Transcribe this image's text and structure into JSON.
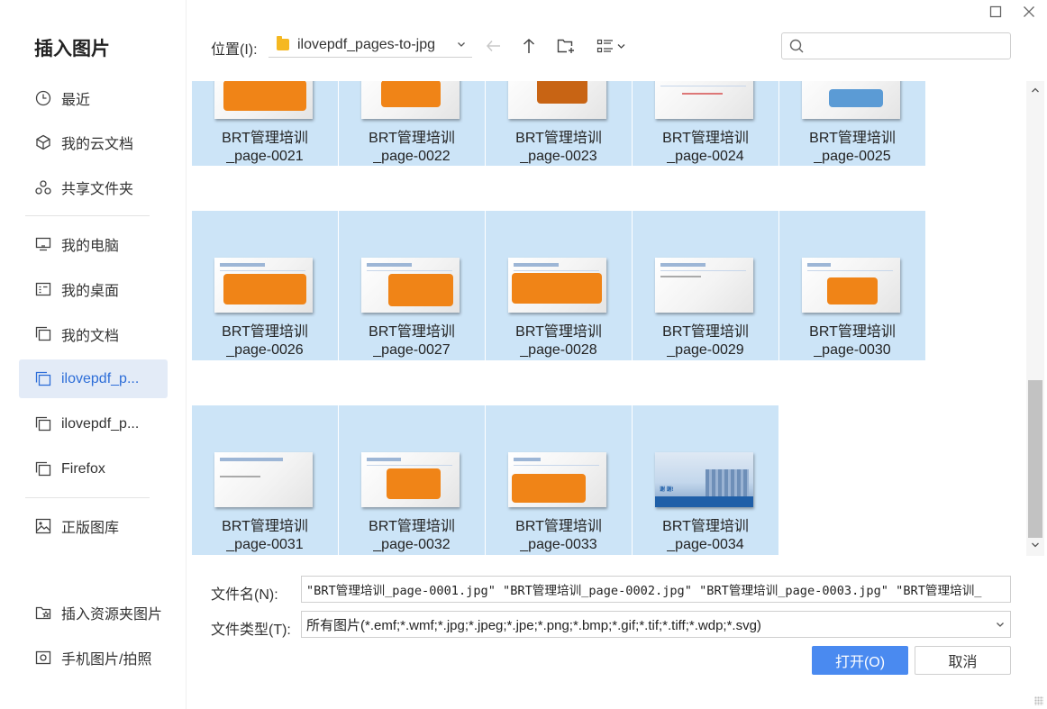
{
  "window": {
    "maximize_icon": "maximize-icon",
    "close_icon": "close-icon"
  },
  "dialog_title": "插入图片",
  "sidebar": {
    "items": [
      {
        "label": "最近",
        "icon": "clock-icon"
      },
      {
        "label": "我的云文档",
        "icon": "cloud-doc-icon"
      },
      {
        "label": "共享文件夹",
        "icon": "shared-folder-icon"
      },
      {
        "label": "我的电脑",
        "icon": "computer-icon"
      },
      {
        "label": "我的桌面",
        "icon": "desktop-icon"
      },
      {
        "label": "我的文档",
        "icon": "documents-icon"
      },
      {
        "label": "ilovepdf_p...",
        "icon": "folder-icon",
        "active": true
      },
      {
        "label": "ilovepdf_p...",
        "icon": "folder-icon"
      },
      {
        "label": "Firefox",
        "icon": "folder-icon"
      },
      {
        "label": "正版图库",
        "icon": "image-library-icon"
      }
    ],
    "bottom_items": [
      {
        "label": "插入资源夹图片",
        "icon": "resource-folder-icon"
      },
      {
        "label": "手机图片/拍照",
        "icon": "phone-photo-icon"
      }
    ]
  },
  "toolbar": {
    "location_label": "位置(I):",
    "location_value": "ilovepdf_pages-to-jpg",
    "search_placeholder": ""
  },
  "files": [
    {
      "line1": "BRT管理培训",
      "line2": "_page-0021"
    },
    {
      "line1": "BRT管理培训",
      "line2": "_page-0022"
    },
    {
      "line1": "BRT管理培训",
      "line2": "_page-0023"
    },
    {
      "line1": "BRT管理培训",
      "line2": "_page-0024"
    },
    {
      "line1": "BRT管理培训",
      "line2": "_page-0025"
    },
    {
      "line1": "BRT管理培训",
      "line2": "_page-0026"
    },
    {
      "line1": "BRT管理培训",
      "line2": "_page-0027"
    },
    {
      "line1": "BRT管理培训",
      "line2": "_page-0028"
    },
    {
      "line1": "BRT管理培训",
      "line2": "_page-0029"
    },
    {
      "line1": "BRT管理培训",
      "line2": "_page-0030"
    },
    {
      "line1": "BRT管理培训",
      "line2": "_page-0031"
    },
    {
      "line1": "BRT管理培训",
      "line2": "_page-0032"
    },
    {
      "line1": "BRT管理培训",
      "line2": "_page-0033"
    },
    {
      "line1": "BRT管理培训",
      "line2": "_page-0034"
    }
  ],
  "form": {
    "filename_label": "文件名(N):",
    "filename_value": "\"BRT管理培训_page-0001.jpg\" \"BRT管理培训_page-0002.jpg\" \"BRT管理培训_page-0003.jpg\" \"BRT管理培训_",
    "filetype_label": "文件类型(T):",
    "filetype_value": "所有图片(*.emf;*.wmf;*.jpg;*.jpeg;*.jpe;*.png;*.bmp;*.gif;*.tif;*.tiff;*.wdp;*.svg)"
  },
  "buttons": {
    "open": "打开(O)",
    "cancel": "取消"
  },
  "colors": {
    "accent": "#4a8af0",
    "selection": "#cce4f7",
    "active_nav": "#e3ebf7",
    "thumb_orange": "#f08417"
  }
}
